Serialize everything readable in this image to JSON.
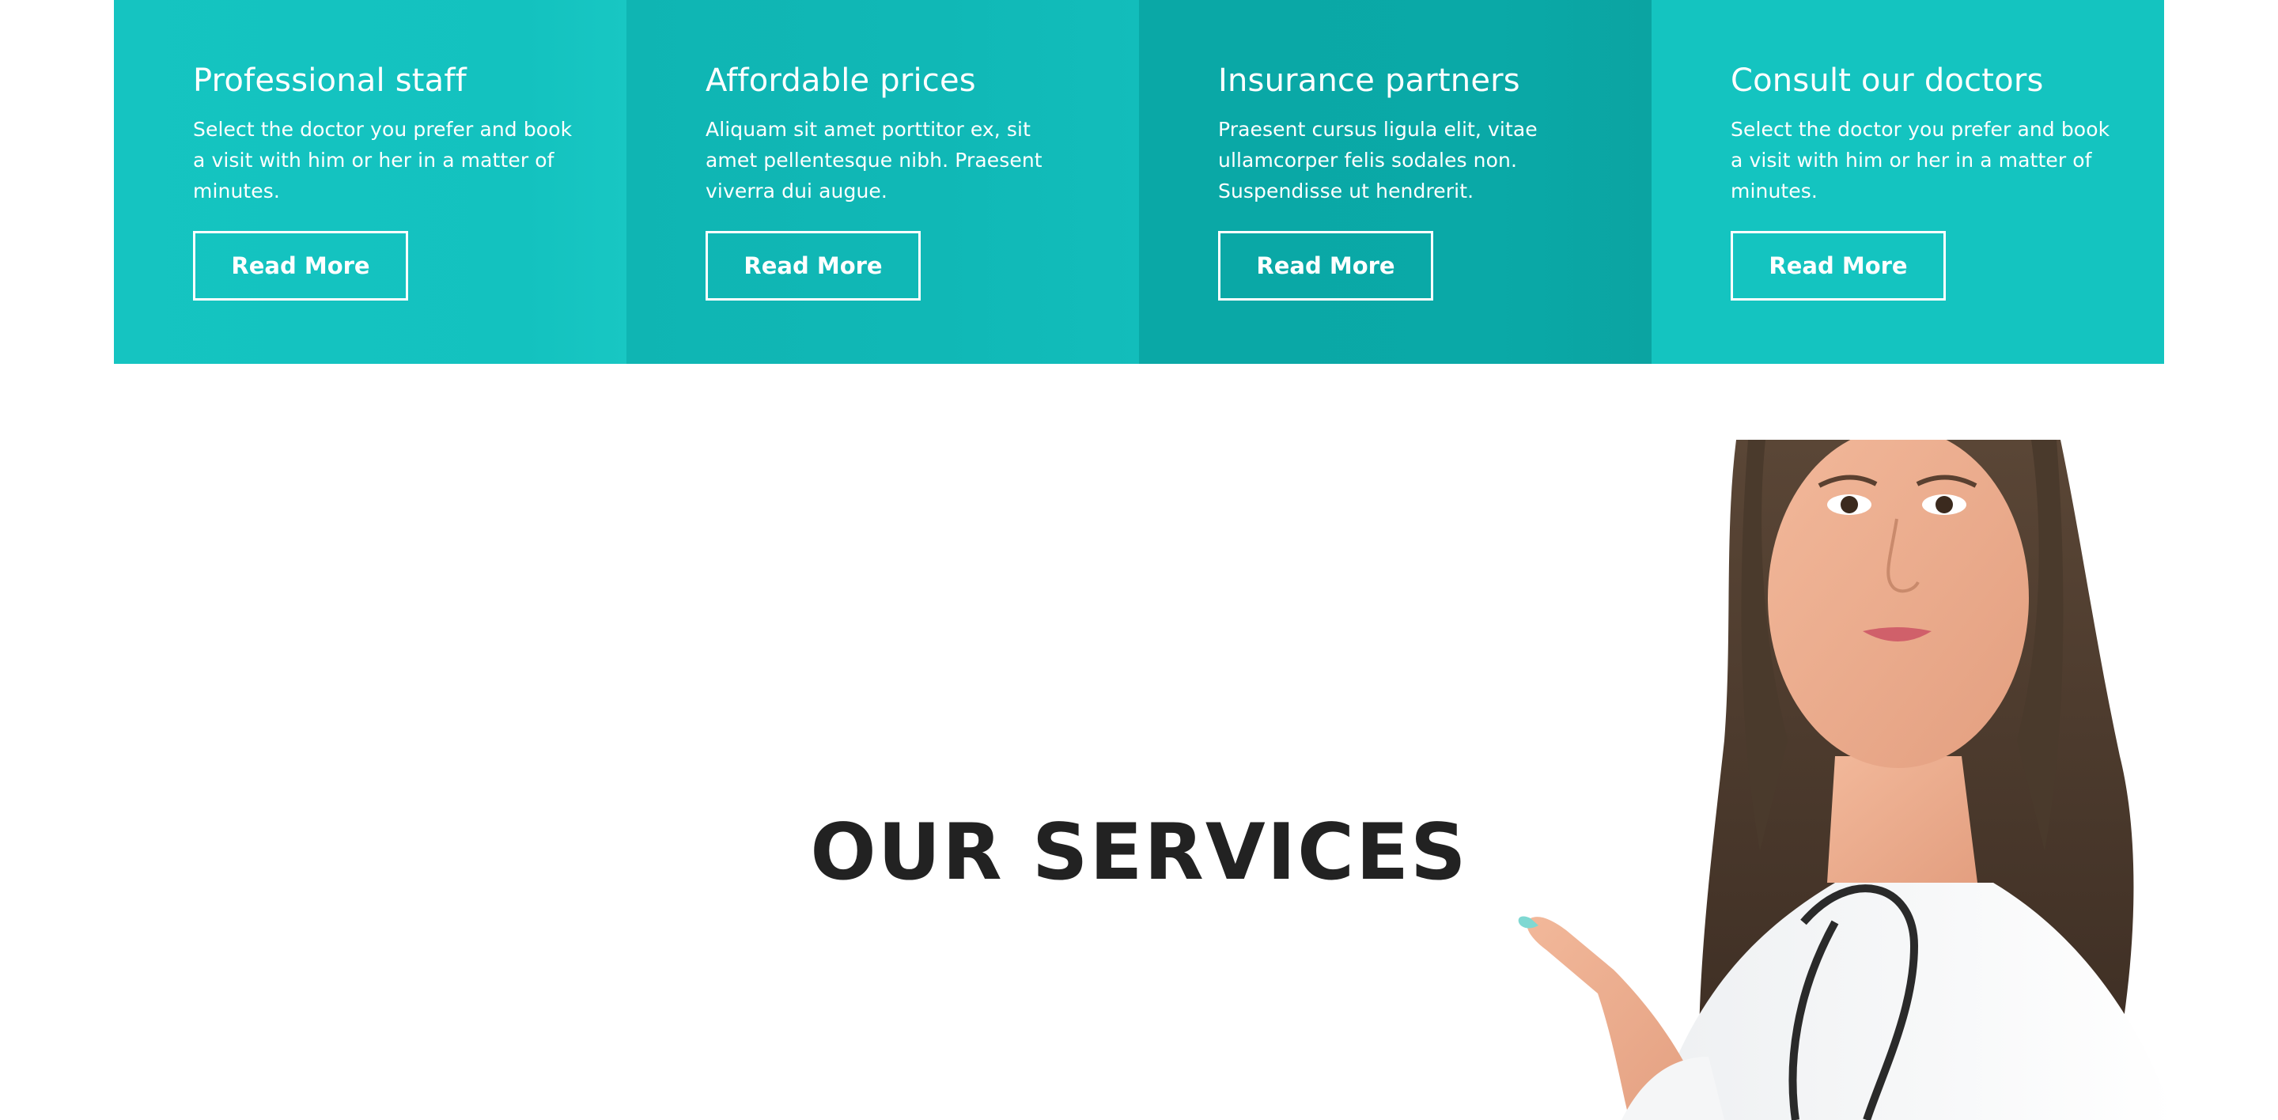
{
  "features": [
    {
      "title": "Professional staff",
      "text": "Select the doctor you prefer and book a visit with him or her in a matter of minutes.",
      "button": "Read More"
    },
    {
      "title": "Affordable prices",
      "text": "Aliquam sit amet porttitor ex, sit amet pellentesque nibh. Praesent viverra dui augue.",
      "button": "Read More"
    },
    {
      "title": "Insurance partners",
      "text": "Praesent cursus ligula elit, vitae ullamcorper felis sodales non. Suspendisse ut hendrerit.",
      "button": "Read More"
    },
    {
      "title": "Consult our doctors",
      "text": "Select the doctor you prefer and book a visit with him or her in a matter of minutes.",
      "button": "Read More"
    }
  ],
  "services": {
    "heading": "OUR SERVICES"
  },
  "colors": {
    "accent": "#14c4c0",
    "accent_dark": "#0aa8a6",
    "heading": "#222222"
  },
  "image": {
    "subject": "doctor-pointing-photo"
  }
}
